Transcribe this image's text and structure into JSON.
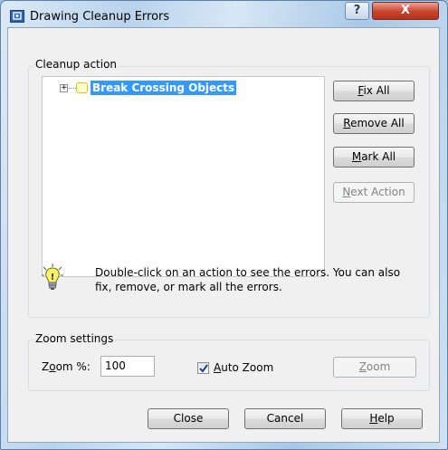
{
  "window": {
    "title": "Drawing Cleanup Errors",
    "help_glyph": "?",
    "close_glyph": "X"
  },
  "cleanup_group": {
    "label": "Cleanup action",
    "tree": {
      "expander": "+",
      "items": [
        {
          "label": "Break Crossing Objects",
          "selected": true
        }
      ]
    },
    "buttons": {
      "fix_all": {
        "pre": "",
        "key": "F",
        "post": "ix All"
      },
      "remove_all": {
        "pre": "",
        "key": "R",
        "post": "emove All"
      },
      "mark_all": {
        "pre": "",
        "key": "M",
        "post": "ark All"
      },
      "next_action": {
        "pre": "",
        "key": "N",
        "post": "ext Action",
        "enabled": false
      }
    },
    "hint": "Double-click on an action to see the errors. You can also fix, remove, or mark all the errors."
  },
  "zoom_group": {
    "label": "Zoom settings",
    "zoom_percent_label": {
      "pre": "Z",
      "key": "o",
      "post": "om %:"
    },
    "zoom_percent_value": "100",
    "auto_zoom": {
      "checked": true,
      "pre": "",
      "key": "A",
      "post": "uto Zoom"
    },
    "zoom_button": {
      "pre": "",
      "key": "Z",
      "post": "oom",
      "enabled": false
    }
  },
  "footer": {
    "close": "Close",
    "cancel": "Cancel",
    "help": {
      "pre": "",
      "key": "H",
      "post": "elp"
    }
  },
  "colors": {
    "selection": "#3399ff",
    "dialog_bg": "#f0f0f0",
    "close_button": "#c8442d"
  }
}
